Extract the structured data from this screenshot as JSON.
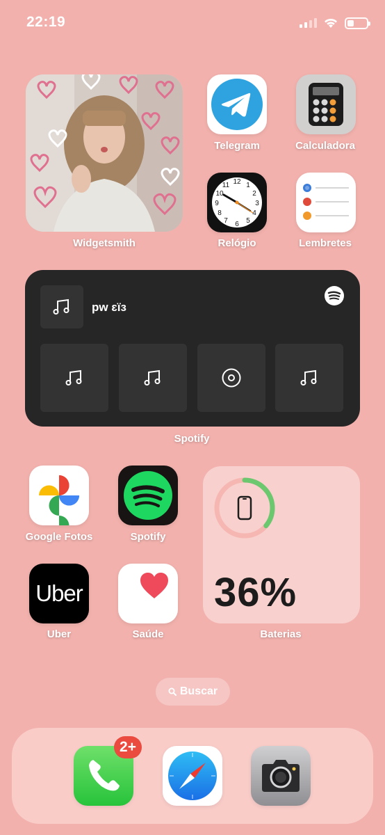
{
  "status": {
    "time": "22:19",
    "battery_level": 0.36
  },
  "apps": {
    "widgetsmith": {
      "label": "Widgetsmith"
    },
    "telegram": {
      "label": "Telegram"
    },
    "calculadora": {
      "label": "Calculadora"
    },
    "relogio": {
      "label": "Relógio"
    },
    "lembretes": {
      "label": "Lembretes"
    },
    "google_fotos": {
      "label": "Google Fotos"
    },
    "spotify": {
      "label": "Spotify"
    },
    "uber": {
      "label": "Uber",
      "logo_text": "Uber"
    },
    "saude": {
      "label": "Saúde"
    },
    "baterias": {
      "label": "Baterias"
    }
  },
  "spotify_widget": {
    "label": "Spotify",
    "now_playing": "pw ɛïɜ",
    "tiles": [
      "music-note-icon",
      "music-note-icon",
      "disc-icon",
      "music-note-icon"
    ]
  },
  "battery_widget": {
    "percent_text": "36%",
    "level": 0.36,
    "ring_color": "#6cc86f"
  },
  "search": {
    "label": "Buscar"
  },
  "dock": {
    "phone_badge": "2+",
    "apps": [
      "phone-icon",
      "safari-icon",
      "camera-icon"
    ]
  },
  "colors": {
    "background": "#f2b1ad",
    "telegram": "#2ea3e0",
    "spotify_green": "#1ed760",
    "badge": "#eb4a3e"
  }
}
